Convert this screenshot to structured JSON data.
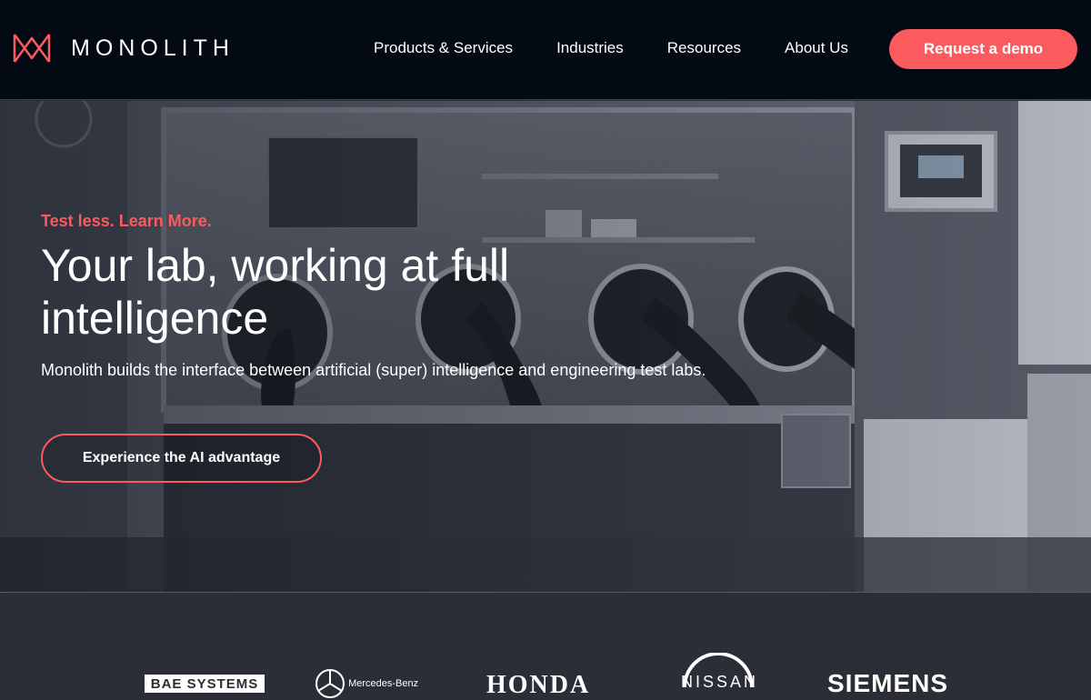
{
  "header": {
    "brand_name": "MONOLITH",
    "nav": [
      {
        "label": "Products & Services"
      },
      {
        "label": "Industries"
      },
      {
        "label": "Resources"
      },
      {
        "label": "About Us"
      }
    ],
    "cta_label": "Request a demo"
  },
  "hero": {
    "eyebrow": "Test less. Learn More.",
    "headline": "Your lab, working at full intelligence",
    "subline": "Monolith builds the interface between artificial (super) intelligence and engineering test labs.",
    "cta_label": "Experience the AI advantage"
  },
  "logos": [
    {
      "name": "BAE SYSTEMS"
    },
    {
      "name": "Mercedes-Benz"
    },
    {
      "name": "HONDA"
    },
    {
      "name": "NISSAN"
    },
    {
      "name": "SIEMENS"
    }
  ],
  "colors": {
    "header_bg": "#030a14",
    "accent": "#fb5a5f",
    "logo_strip_bg": "#2b2e36"
  }
}
